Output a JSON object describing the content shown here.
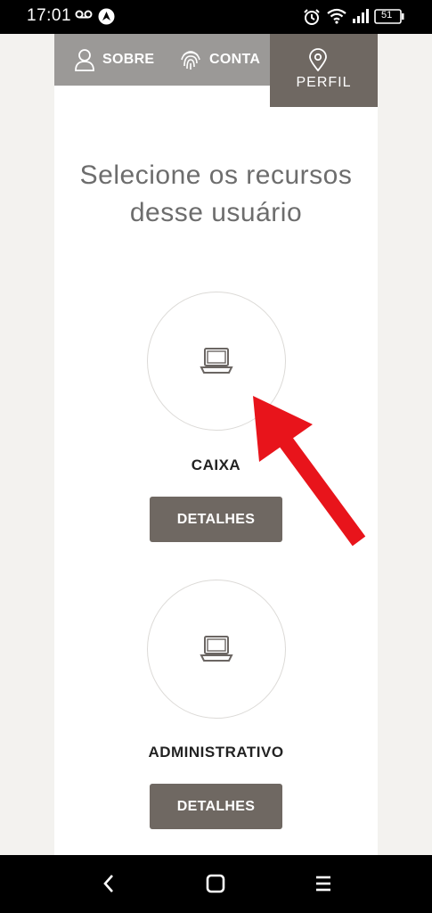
{
  "status_bar": {
    "time": "17:01",
    "battery": "51",
    "icons": [
      "voicemail-icon",
      "location-app-icon",
      "alarm-icon",
      "wifi-icon",
      "signal-icon",
      "battery-icon"
    ]
  },
  "tabs": [
    {
      "label": "SOBRE",
      "icon": "user-icon"
    },
    {
      "label": "CONTA",
      "icon": "fingerprint-icon"
    },
    {
      "label": "PERFIL",
      "icon": "location-pin-icon",
      "active": true
    }
  ],
  "heading": "Selecione os recursos desse usuário",
  "resources": [
    {
      "name": "CAIXA",
      "icon": "laptop-icon",
      "button": "DETALHES"
    },
    {
      "name": "ADMINISTRATIVO",
      "icon": "laptop-icon",
      "button": "DETALHES"
    }
  ],
  "annotation": {
    "color": "#e8141b"
  },
  "nav_bar": {
    "buttons": [
      "back-icon",
      "home-icon",
      "menu-icon"
    ]
  },
  "colors": {
    "accent": "#6f6862",
    "tabbar": "#9b9997",
    "background": "#f3f2ef"
  }
}
